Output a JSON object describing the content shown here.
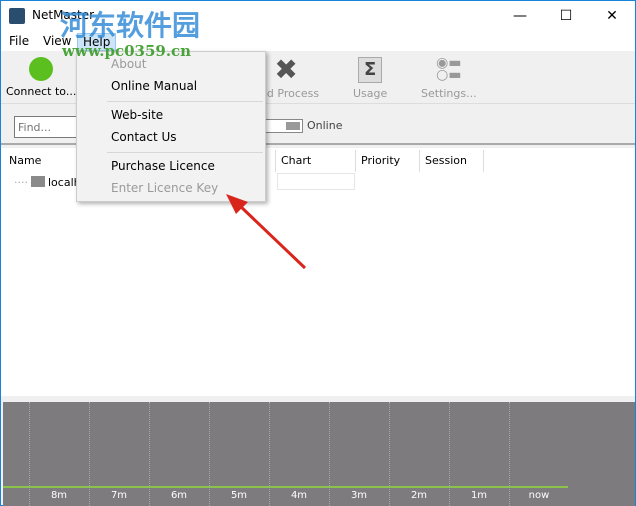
{
  "window": {
    "title": "NetMaster",
    "minimize": "—",
    "maximize": "☐",
    "close": "✕"
  },
  "menubar": {
    "items": [
      "File",
      "View",
      "Help"
    ]
  },
  "toolbar": {
    "connect": "Connect to...",
    "end_process": "End Process",
    "usage": "Usage",
    "settings": "Settings..."
  },
  "filter": {
    "find_placeholder": "Find...",
    "online_label": "Online"
  },
  "table": {
    "columns": [
      "Name",
      "Chart",
      "Priority",
      "Session"
    ],
    "rows": [
      {
        "name": "localhost"
      }
    ]
  },
  "help_menu": {
    "items": [
      {
        "label": "About",
        "enabled": false
      },
      {
        "label": "Online Manual",
        "enabled": true
      },
      {
        "label": "Web-site",
        "enabled": true
      },
      {
        "label": "Contact Us",
        "enabled": true
      },
      {
        "label": "Purchase Licence",
        "enabled": true
      },
      {
        "label": "Enter Licence Key",
        "enabled": false
      }
    ]
  },
  "graph": {
    "ticks": [
      "8m",
      "7m",
      "6m",
      "5m",
      "4m",
      "3m",
      "2m",
      "1m",
      "now"
    ]
  },
  "watermark": {
    "text": "河东软件园",
    "url": "www.pc0359.cn"
  },
  "colors": {
    "accent": "#1883d7",
    "graph_bg": "#7e7b7e",
    "graph_line": "#8bc34a",
    "connect": "#5bbf1f",
    "arrow": "#d9261c"
  }
}
